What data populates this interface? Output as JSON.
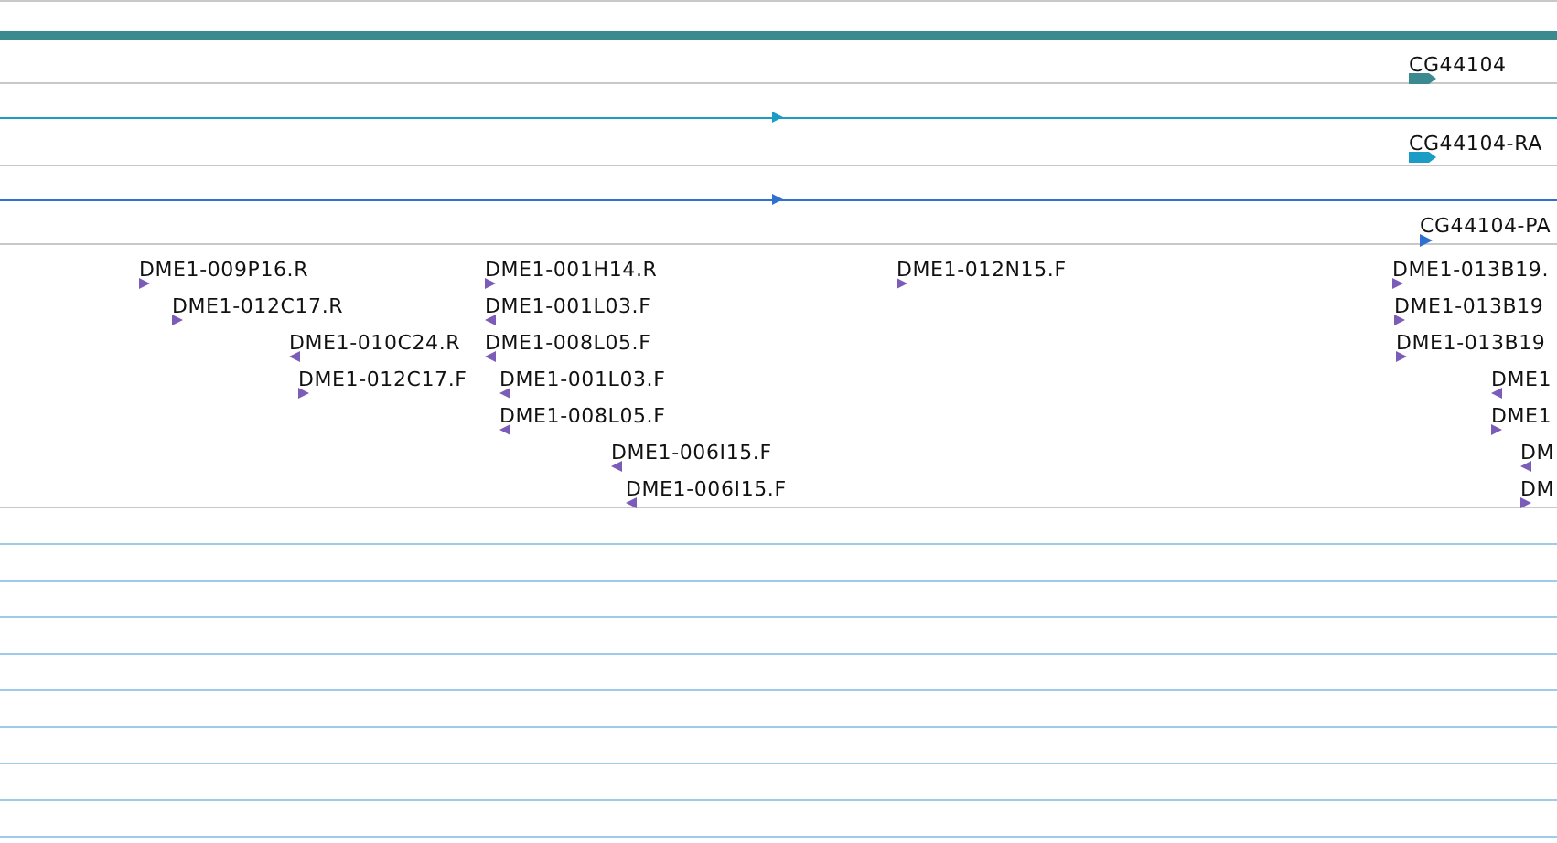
{
  "gene_tracks": [
    {
      "kind": "gene",
      "label": "CG44104",
      "color": "#3a8a8f"
    },
    {
      "kind": "transcript",
      "label": "CG44104-RA",
      "color": "#1a9cc4"
    },
    {
      "kind": "protein",
      "label": "CG44104-PA",
      "color": "#3070d0"
    }
  ],
  "est_track": {
    "features": [
      {
        "label": "DME1-009P16.R",
        "reverse": false
      },
      {
        "label": "DME1-012C17.R",
        "reverse": false
      },
      {
        "label": "DME1-010C24.R",
        "reverse": true
      },
      {
        "label": "DME1-012C17.F",
        "reverse": false
      },
      {
        "label": "DME1-001H14.R",
        "reverse": false
      },
      {
        "label": "DME1-001L03.F",
        "reverse": true
      },
      {
        "label": "DME1-008L05.F",
        "reverse": true
      },
      {
        "label": "DME1-001L03.F",
        "reverse": true
      },
      {
        "label": "DME1-008L05.F",
        "reverse": true
      },
      {
        "label": "DME1-006I15.F",
        "reverse": true
      },
      {
        "label": "DME1-006I15.F",
        "reverse": true
      },
      {
        "label": "DME1-012N15.F",
        "reverse": false
      },
      {
        "label": "DME1-013B19.",
        "reverse": false
      },
      {
        "label": "DME1-013B19",
        "reverse": false
      },
      {
        "label": "DME1-013B19",
        "reverse": false
      },
      {
        "label": "DME1",
        "reverse": true
      },
      {
        "label": "DME1",
        "reverse": false
      },
      {
        "label": "DM",
        "reverse": true
      },
      {
        "label": "DM",
        "reverse": false
      }
    ]
  }
}
